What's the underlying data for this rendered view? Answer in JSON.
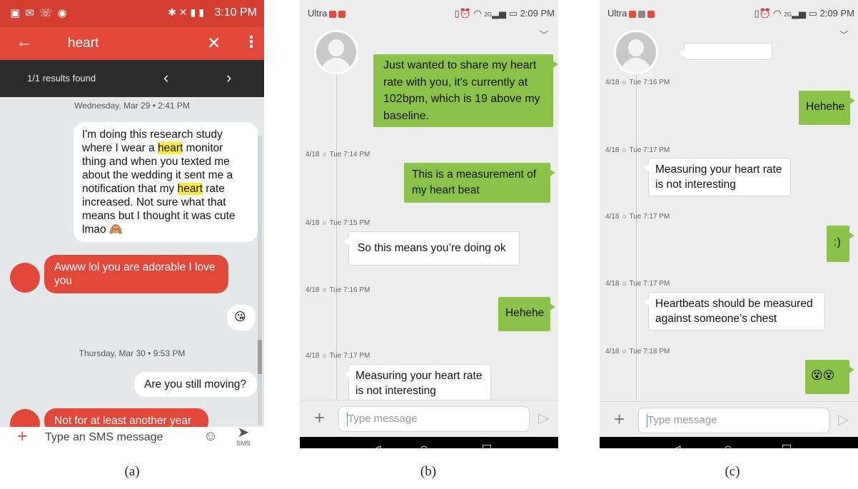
{
  "panel_a": {
    "status_time": "3:10 PM",
    "search_query": "heart",
    "results_text": "1/1 results found",
    "day1": "Wednesday, Mar 29 • 2:41 PM",
    "msg1_parts": [
      "I'm doing this research study where I wear a ",
      "heart",
      " monitor thing and when you texted me about the wedding it sent me a notification that my ",
      "heart",
      " rate increased. Not sure what that means but I thought it was cute lmao 🙈"
    ],
    "msg2": "Awww lol you are adorable I love you",
    "msg3": "😘",
    "day2": "Thursday, Mar 30 • 9:53 PM",
    "msg4": "Are you still moving?",
    "msg5": "Not for at least another year",
    "input_placeholder": "Type an SMS message",
    "send_label": "SMS",
    "caption": "(a)"
  },
  "panel_b": {
    "carrier": "Ultra",
    "status_time": "2:09 PM",
    "network": "2G",
    "msg1": "Just wanted to share my heart rate with you, it's currently at 102bpm, which is 19 above my baseline.",
    "ts1_date": "4/18",
    "ts1_time": "Tue 7:14 PM",
    "msg2": "This is a measurement of my heart beat",
    "ts2_date": "4/18",
    "ts2_time": "Tue 7:15 PM",
    "msg3": "So this means you’re doing ok",
    "ts3_date": "4/18",
    "ts3_time": "Tue 7:16 PM",
    "msg4": "Hehehe",
    "ts4_date": "4/18",
    "ts4_time": "Tue 7:17 PM",
    "msg5": "Measuring your heart rate is not interesting",
    "input_placeholder": "Type message",
    "caption": "(b)"
  },
  "panel_c": {
    "carrier": "Ultra",
    "status_time": "2:09 PM",
    "network": "2G",
    "ts1_date": "4/18",
    "ts1_time": "Tue 7:16 PM",
    "msg1": "Hehehe",
    "ts2_date": "4/18",
    "ts2_time": "Tue 7:17 PM",
    "msg2": "Measuring your heart rate is not interesting",
    "ts3_date": "4/18",
    "ts3_time": "Tue 7:17 PM",
    "msg3": ":)",
    "ts4_date": "4/18",
    "ts4_time": "Tue 7:17 PM",
    "msg4": "Heartbeats should be measured against someone’s chest",
    "ts5_date": "4/18",
    "ts5_time": "Tue 7:18 PM",
    "msg5": "😵😵",
    "input_placeholder": "Type message",
    "caption": "(c)"
  }
}
